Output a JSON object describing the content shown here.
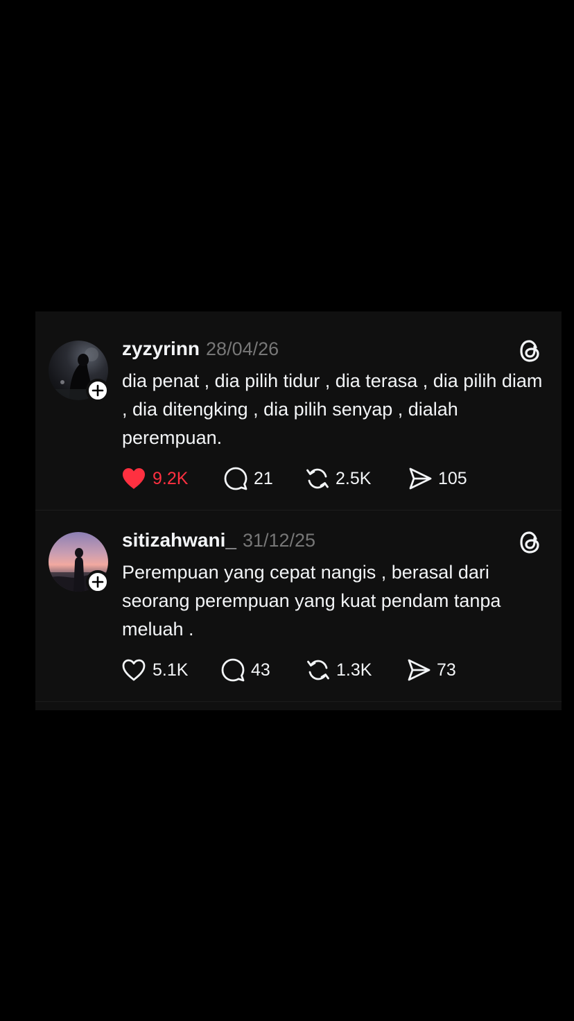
{
  "colors": {
    "background": "#000000",
    "card": "#101010",
    "text": "#f3f5f7",
    "muted": "#777777",
    "liked": "#ff3040"
  },
  "posts": [
    {
      "username": "zyzyrinn",
      "date": "28/04/26",
      "text": "dia penat , dia pilih tidur , dia terasa , dia pilih diam , dia ditengking , dia pilih senyap , dialah perempuan.",
      "liked": true,
      "likes": "9.2K",
      "replies": "21",
      "reposts": "2.5K",
      "shares": "105",
      "icons": [
        "heart-filled-icon",
        "comment-icon",
        "repost-icon",
        "share-icon",
        "threads-logo-icon",
        "plus-icon"
      ]
    },
    {
      "username": "sitizahwani_",
      "date": "31/12/25",
      "text": "Perempuan yang cepat nangis , berasal dari seorang perempuan yang kuat pendam tanpa meluah .",
      "liked": false,
      "likes": "5.1K",
      "replies": "43",
      "reposts": "1.3K",
      "shares": "73",
      "icons": [
        "heart-icon",
        "comment-icon",
        "repost-icon",
        "share-icon",
        "threads-logo-icon",
        "plus-icon"
      ]
    }
  ]
}
